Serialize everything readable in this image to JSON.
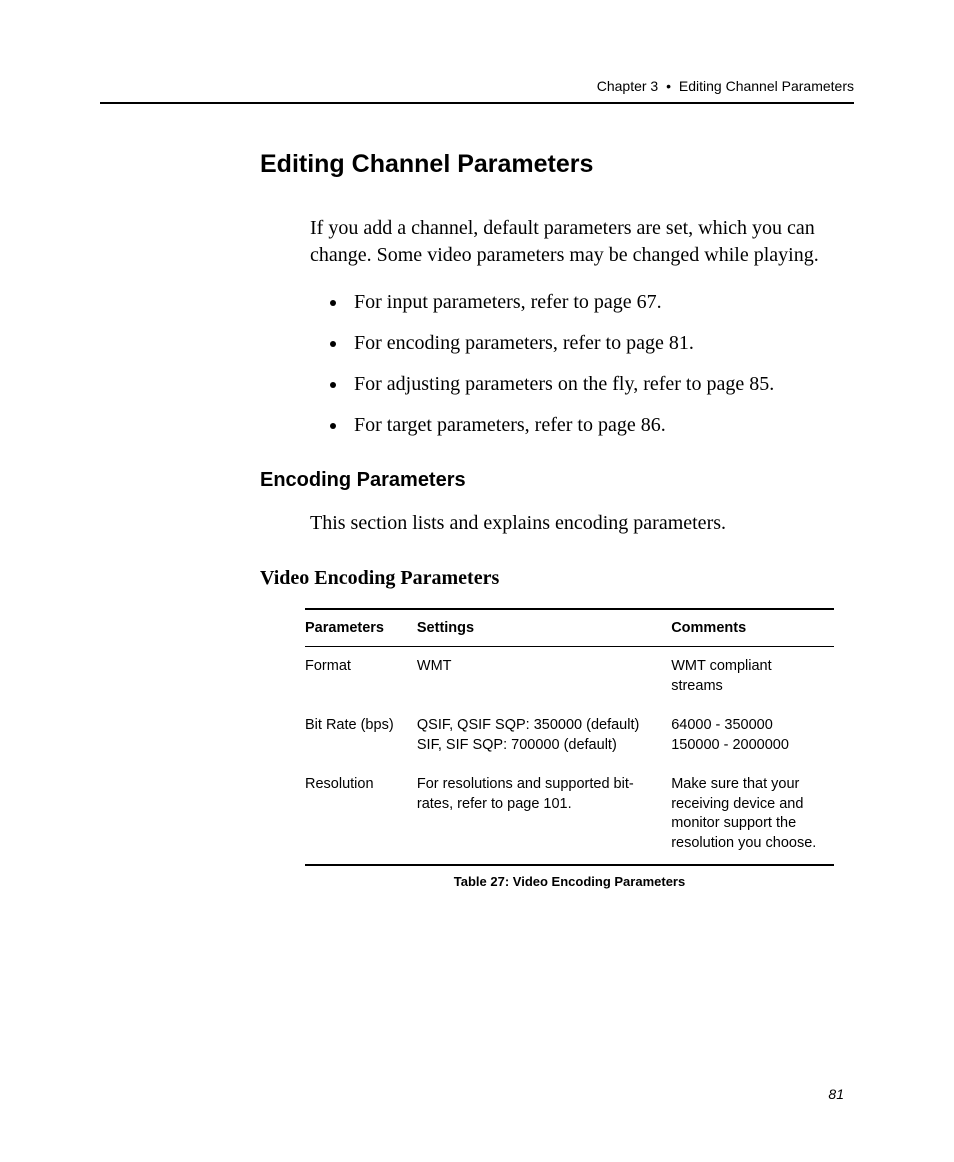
{
  "header": {
    "chapter": "Chapter 3",
    "separator": "•",
    "section": "Editing Channel Parameters"
  },
  "title": "Editing Channel Parameters",
  "intro": "If you add a channel, default parameters are set, which you can change. Some video parameters may be changed while playing.",
  "bullets": [
    "For input parameters, refer to page 67.",
    "For encoding parameters, refer to page 81.",
    "For adjusting parameters on the fly, refer to page 85.",
    "For target parameters, refer to page 86."
  ],
  "subheading1": "Encoding Parameters",
  "sub1_body": "This section lists and explains encoding parameters.",
  "subheading2": "Video Encoding Parameters",
  "table": {
    "headers": {
      "c0": "Parameters",
      "c1": "Settings",
      "c2": "Comments"
    },
    "rows": [
      {
        "c0": "Format",
        "c1": "WMT",
        "c2": "WMT compliant streams"
      },
      {
        "c0": "Bit Rate (bps)",
        "c1": "QSIF, QSIF SQP: 350000 (default)\nSIF, SIF SQP: 700000 (default)",
        "c2": "64000 - 350000\n150000 - 2000000"
      },
      {
        "c0": "Resolution",
        "c1": "For resolutions and supported bit-rates, refer to page 101.",
        "c2": "Make sure that your receiving device and monitor support the resolution you choose."
      }
    ],
    "caption": "Table  27:  Video Encoding Parameters"
  },
  "page_number": "81"
}
